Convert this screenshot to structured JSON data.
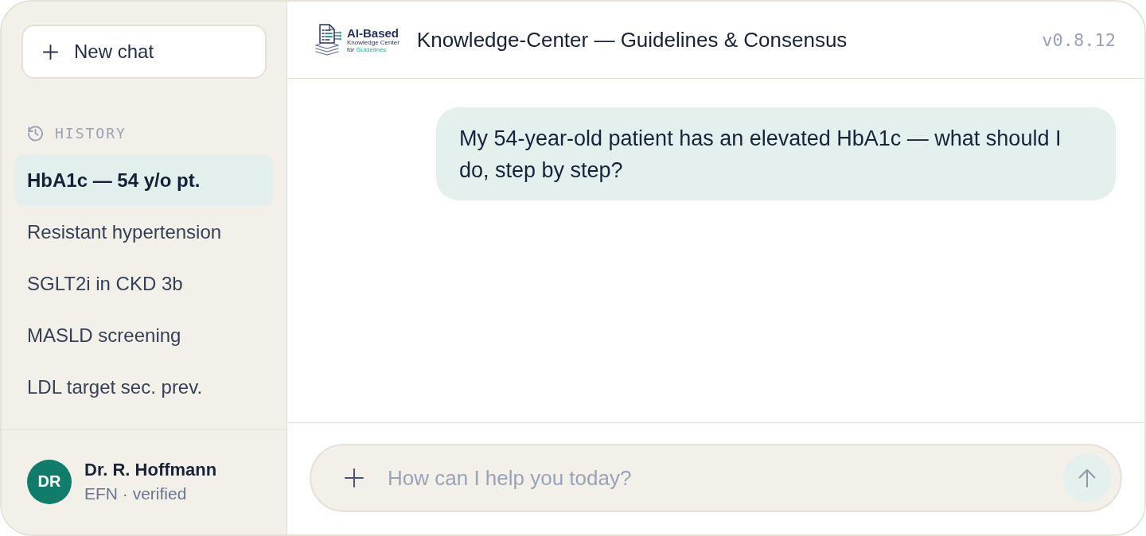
{
  "sidebar": {
    "new_chat_button": "New chat",
    "history_label": "HISTORY",
    "history": [
      {
        "title": "HbA1c — 54 y/o pt.",
        "selected": true
      },
      {
        "title": "Resistant hypertension",
        "selected": false
      },
      {
        "title": "SGLT2i in CKD 3b",
        "selected": false
      },
      {
        "title": "MASLD screening",
        "selected": false
      },
      {
        "title": "LDL target sec. prev.",
        "selected": false
      }
    ],
    "user": {
      "initials": "DR",
      "name": "Dr. R. Hoffmann",
      "status": "EFN · verified"
    }
  },
  "header": {
    "logo": {
      "title": "AI-Based",
      "subtitle": "Knowledge Center",
      "tagline_lead": "for",
      "tagline_accent": "Guidelines"
    },
    "title": "Knowledge-Center — Guidelines & Consensus",
    "version": "v0.8.12"
  },
  "messages": [
    {
      "kind": "user",
      "text": "My 54-year-old patient has an elevated HbA1c — what should I do, step by step?"
    }
  ],
  "composer": {
    "placeholder": "How can I help you today?"
  }
}
